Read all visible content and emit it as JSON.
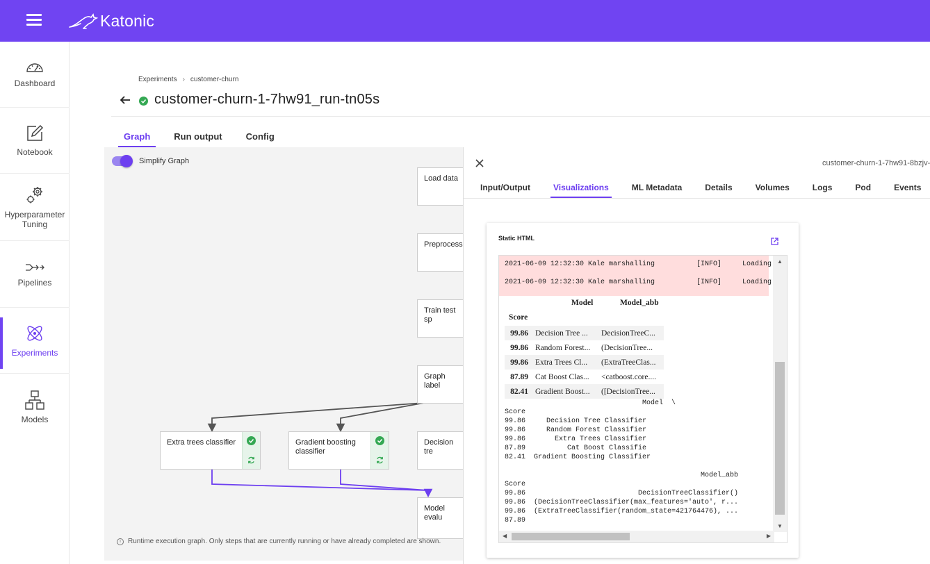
{
  "brand": {
    "name": "Katonic",
    "bar_color": "#7044f2"
  },
  "nav": [
    {
      "label": "Dashboard",
      "icon": "gauge-icon"
    },
    {
      "label": "Notebook",
      "icon": "edit-icon"
    },
    {
      "label": "Hyperparameter Tuning",
      "icon": "gears-icon"
    },
    {
      "label": "Pipelines",
      "icon": "pipeline-icon"
    },
    {
      "label": "Experiments",
      "icon": "atom-icon",
      "active": true
    },
    {
      "label": "Models",
      "icon": "models-icon"
    }
  ],
  "breadcrumb": [
    "Experiments",
    "customer-churn"
  ],
  "run_title": "customer-churn-1-7hw91_run-tn05s",
  "tabs": [
    "Graph",
    "Run output",
    "Config"
  ],
  "graph": {
    "toggle_label": "Simplify Graph",
    "nodes": {
      "load_data": "Load data",
      "preprocess": "Preprocess",
      "train_test": "Train test sp",
      "graph_labels": "Graph label",
      "extra_trees": "Extra trees classifier",
      "gradient_boosting": "Gradient boosting classifier",
      "decision_tree": "Decision tre",
      "model_eval": "Model evalu"
    },
    "note": "Runtime execution graph. Only steps that are currently running or have already completed are shown."
  },
  "panel": {
    "run_id": "customer-churn-1-7hw91-8bzjv-",
    "tabs": [
      "Input/Output",
      "Visualizations",
      "ML Metadata",
      "Details",
      "Volumes",
      "Logs",
      "Pod",
      "Events"
    ],
    "card_title": "Static HTML",
    "logs": [
      "2021-06-09 12:32:30 Kale marshalling          [INFO]     Loading",
      "2021-06-09 12:32:30 Kale marshalling          [INFO]     Loading"
    ],
    "df_header": {
      "model": "Model",
      "abb": "Model_abb",
      "index": "Score"
    },
    "df_rows": [
      {
        "score": "99.86",
        "model": "Decision Tree ...",
        "abb": "DecisionTreeC..."
      },
      {
        "score": "99.86",
        "model": "Random Forest...",
        "abb": "(DecisionTree..."
      },
      {
        "score": "99.86",
        "model": "Extra Trees Cl...",
        "abb": "(ExtraTreeClas..."
      },
      {
        "score": "87.89",
        "model": "Cat Boost Clas...",
        "abb": "<catboost.core...."
      },
      {
        "score": "82.41",
        "model": "Gradient Boost...",
        "abb": "([DecisionTree..."
      }
    ],
    "pre_text": "                                 Model  \\\nScore                                   \n99.86     Decision Tree Classifier\n99.86     Random Forest Classifier\n99.86       Extra Trees Classifier\n87.89          Cat Boost Classifie\n82.41  Gradient Boosting Classifier\n\n                                               Model_abb\nScore                                                   \n99.86                           DecisionTreeClassifier()\n99.86  (DecisionTreeClassifier(max_features='auto', r...\n99.86  (ExtraTreeClassifier(random_state=421764476), ...\n87.89"
  }
}
